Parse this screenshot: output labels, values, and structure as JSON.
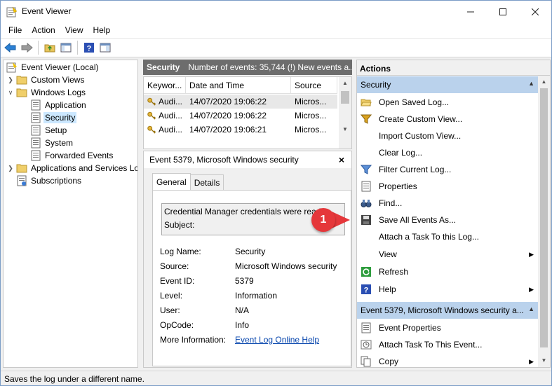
{
  "window": {
    "title": "Event Viewer"
  },
  "menu": [
    "File",
    "Action",
    "View",
    "Help"
  ],
  "tree": {
    "root": "Event Viewer (Local)",
    "custom_views": "Custom Views",
    "windows_logs": "Windows Logs",
    "application": "Application",
    "security": "Security",
    "setup": "Setup",
    "system": "System",
    "forwarded": "Forwarded Events",
    "apps_services": "Applications and Services Lo",
    "subscriptions": "Subscriptions"
  },
  "log_header": {
    "name": "Security",
    "info": "Number of events: 35,744 (!) New events a..."
  },
  "grid": {
    "columns": [
      "Keywor...",
      "Date and Time",
      "Source"
    ],
    "rows": [
      {
        "keyword": "Audi...",
        "datetime": "14/07/2020 19:06:22",
        "source": "Micros..."
      },
      {
        "keyword": "Audi...",
        "datetime": "14/07/2020 19:06:22",
        "source": "Micros..."
      },
      {
        "keyword": "Audi...",
        "datetime": "14/07/2020 19:06:21",
        "source": "Micros..."
      }
    ]
  },
  "detail": {
    "title": "Event 5379, Microsoft Windows security",
    "close": "×",
    "tabs": [
      "General",
      "Details"
    ],
    "description_line1": "Credential Manager credentials were read",
    "description_line2": "Subject:",
    "props": {
      "log_name_k": "Log Name:",
      "log_name_v": "Security",
      "source_k": "Source:",
      "source_v": "Microsoft Windows security",
      "event_id_k": "Event ID:",
      "event_id_v": "5379",
      "level_k": "Level:",
      "level_v": "Information",
      "user_k": "User:",
      "user_v": "N/A",
      "opcode_k": "OpCode:",
      "opcode_v": "Info",
      "more_k": "More Information:",
      "more_v": "Event Log Online Help"
    }
  },
  "actions": {
    "title": "Actions",
    "section1": "Security",
    "items": {
      "open_saved": "Open Saved Log...",
      "create_view": "Create Custom View...",
      "import_view": "Import Custom View...",
      "clear_log": "Clear Log...",
      "filter": "Filter Current Log...",
      "properties": "Properties",
      "find": "Find...",
      "save_all": "Save All Events As...",
      "attach_log": "Attach a Task To this Log...",
      "view": "View",
      "refresh": "Refresh",
      "help": "Help"
    },
    "section2": "Event 5379, Microsoft Windows security a...",
    "items2": {
      "event_props": "Event Properties",
      "attach_event": "Attach Task To This Event...",
      "copy": "Copy"
    }
  },
  "callout": "1",
  "status": "Saves the log under a different name."
}
